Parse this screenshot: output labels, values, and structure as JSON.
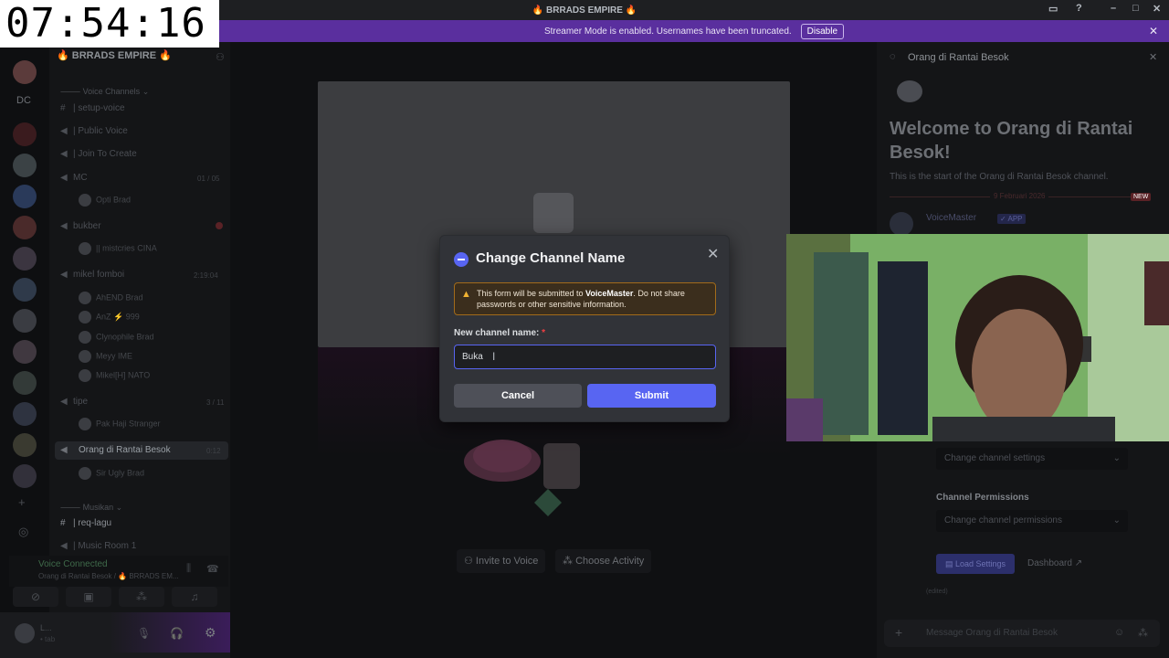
{
  "clock": "07:54:16",
  "window": {
    "title": "🔥 BRRADS EMPIRE 🔥"
  },
  "banner": {
    "text": "Streamer Mode is enabled. Usernames have been truncated.",
    "button": "Disable"
  },
  "server": {
    "name": "🔥 BRRADS EMPIRE 🔥",
    "rail_label": "DC"
  },
  "channels": {
    "cat_voice": "Voice Channels",
    "setup_voice": "| setup-voice",
    "public_voice": "| Public Voice",
    "join_to_create": "| Join To Create",
    "mc": "MC",
    "mc_count": "01 / 05",
    "mc_user": "Opti",
    "mc_user_tag": "Brad",
    "bukber": "bukber",
    "bukber_user": "|| mistcries",
    "bukber_user_tag": "CINA",
    "mikel": "mikel fomboi",
    "mikel_time": "2:19:04",
    "mikel_users": [
      {
        "name": "AhEND",
        "tag": "Brad"
      },
      {
        "name": "AnZ",
        "tag": "⚡ 999"
      },
      {
        "name": "Clynophile",
        "tag": "Brad"
      },
      {
        "name": "Meyy",
        "tag": "IME"
      },
      {
        "name": "Mikel[H]",
        "tag": "NATO"
      }
    ],
    "tipe": "tipe",
    "tipe_count": "3 / 11",
    "tipe_user": "Pak Haji Stranger",
    "orang": "Orang di Rantai Besok",
    "orang_time": "0:12",
    "orang_user": "Sir Ugly",
    "orang_user_tag": "Brad",
    "cat_musik": "Musikan",
    "req_lagu": "| req-lagu",
    "music_room": "| Music Room 1"
  },
  "voice": {
    "status": "Voice Connected",
    "location": "Orang di Rantai Besok / 🔥 BRRADS EM..."
  },
  "userbar": {
    "name": "L...",
    "status": "• tab"
  },
  "stage": {
    "invite": "Invite to Voice",
    "activity": "Choose Activity"
  },
  "rpanel": {
    "title": "Orang di Rantai Besok",
    "welcome": "Welcome to Orang di Rantai Besok!",
    "sub": "This is the start of the Orang di Rantai Besok channel.",
    "date": "9 Februari 2026",
    "new_badge": "NEW",
    "bot_name": "VoiceMaster",
    "bot_badge": "✓ APP",
    "settings_sel": "Change channel settings",
    "perm_title": "Channel Permissions",
    "perm_sel": "Change channel permissions",
    "load": "Load Settings",
    "dashboard": "Dashboard",
    "edited": "(edited)",
    "input_placeholder": "Message Orang di Rantai Besok"
  },
  "modal": {
    "title": "Change Channel Name",
    "warn_pre": "This form will be submitted to ",
    "warn_bold": "VoiceMaster",
    "warn_post": ". Do not share passwords or other sensitive information.",
    "label": "New channel name:",
    "required": "*",
    "value": "Buka",
    "cancel": "Cancel",
    "submit": "Submit"
  },
  "colors": {
    "accent": "#5865f2",
    "banner": "#5a2f9e",
    "warn_border": "#a26b1a"
  }
}
